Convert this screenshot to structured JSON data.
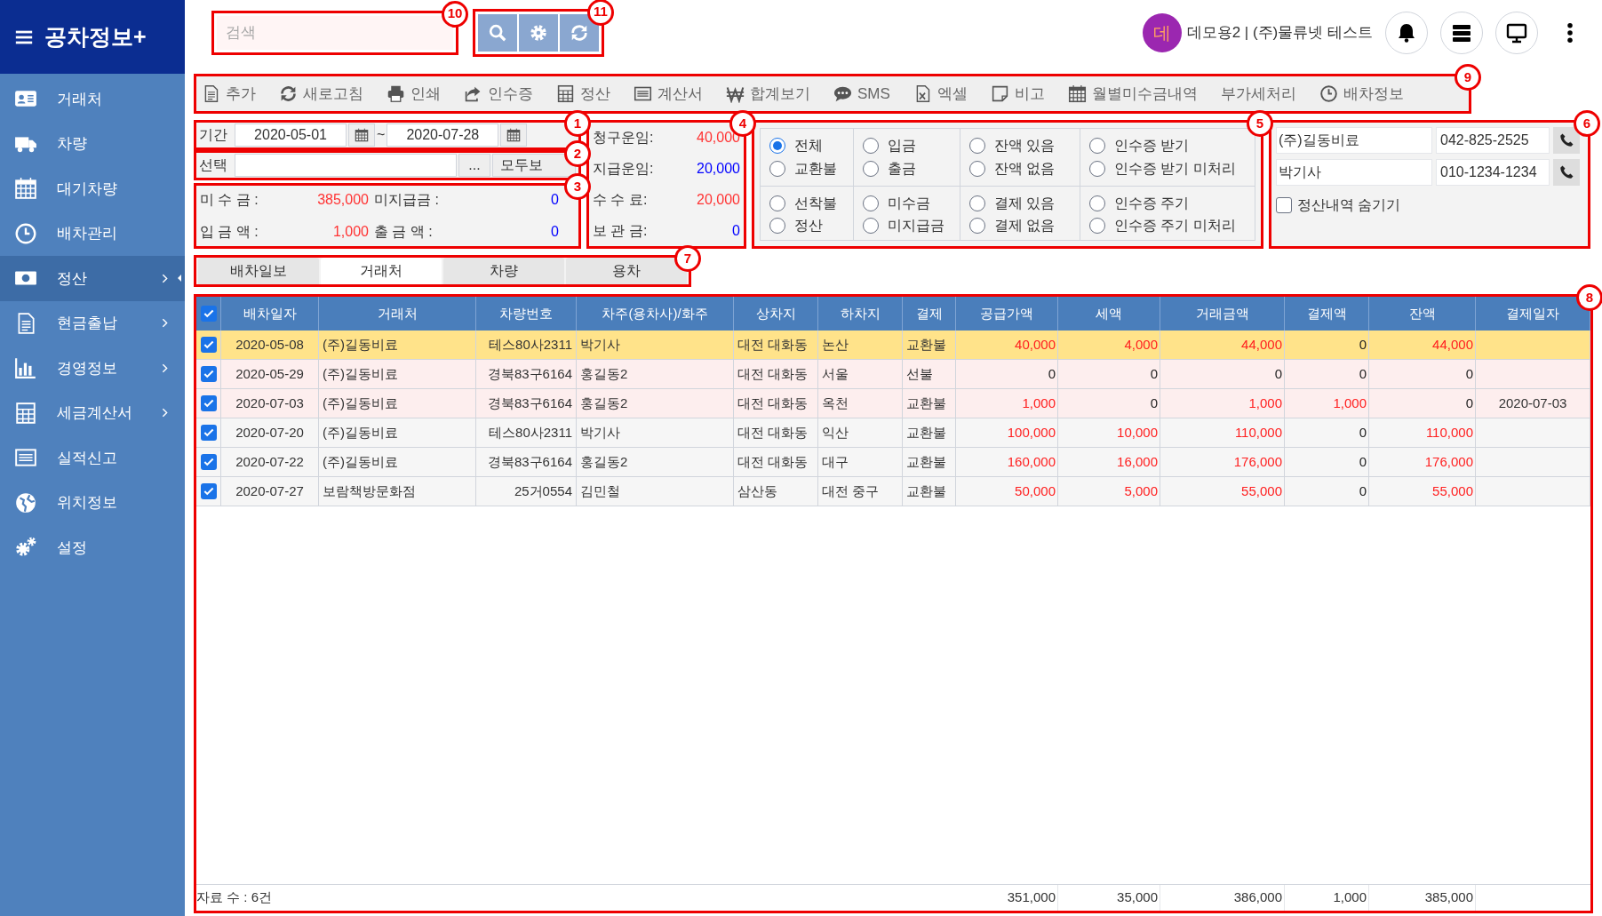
{
  "sidebar": {
    "brand": "공차정보+",
    "items": [
      {
        "label": "거래처",
        "selected": false,
        "submenu": false
      },
      {
        "label": "차량",
        "selected": false,
        "submenu": false
      },
      {
        "label": "대기차량",
        "selected": false,
        "submenu": false
      },
      {
        "label": "배차관리",
        "selected": false,
        "submenu": false
      },
      {
        "label": "정산",
        "selected": true,
        "submenu": true
      },
      {
        "label": "현금출납",
        "selected": false,
        "submenu": true
      },
      {
        "label": "경영정보",
        "selected": false,
        "submenu": true
      },
      {
        "label": "세금계산서",
        "selected": false,
        "submenu": true
      },
      {
        "label": "실적신고",
        "selected": false,
        "submenu": false
      },
      {
        "label": "위치정보",
        "selected": false,
        "submenu": false
      },
      {
        "label": "설정",
        "selected": false,
        "submenu": false
      }
    ]
  },
  "topbar": {
    "search": {
      "placeholder": "검색",
      "callout": "10"
    },
    "tool_buttons": {
      "callout": "11"
    },
    "avatar": "데",
    "user": "데모용2 | (주)물류넷 테스트"
  },
  "toolbar": {
    "callout": "9",
    "items": [
      "추가",
      "새로고침",
      "인쇄",
      "인수증",
      "정산",
      "계산서",
      "합계보기",
      "SMS",
      "엑셀",
      "비고",
      "월별미수금내역",
      "부가세처리",
      "배차정보"
    ]
  },
  "period": {
    "callout": "1",
    "label": "기간",
    "from": "2020-05-01",
    "separator": "~",
    "to": "2020-07-28"
  },
  "selection": {
    "callout": "2",
    "label": "선택",
    "more_button": "...",
    "all_button": "모두보"
  },
  "balances": {
    "callout": "3",
    "items": [
      {
        "label": "미 수 금 :",
        "value": "385,000",
        "color": "#ff3333"
      },
      {
        "label": "미지급금 :",
        "value": "0",
        "color": "#0000ff"
      },
      {
        "label": "입 금 액 :",
        "value": "1,000",
        "color": "#ff3333"
      },
      {
        "label": "출 금 액 :",
        "value": "0",
        "color": "#0000ff"
      }
    ]
  },
  "fees": {
    "callout": "4",
    "items": [
      {
        "label": "청구운임:",
        "value": "40,000",
        "color": "#ff3333"
      },
      {
        "label": "지급운임:",
        "value": "20,000",
        "color": "#0000ff"
      },
      {
        "label": "수 수 료:",
        "value": "20,000",
        "color": "#ff3333"
      },
      {
        "label": "보 관 금:",
        "value": "0",
        "color": "#0000ff"
      }
    ]
  },
  "filters": {
    "callout": "5",
    "groups": [
      {
        "options": [
          {
            "label": "전체",
            "selected": true
          },
          {
            "label": "교환불",
            "selected": false
          },
          {
            "label": "선착불",
            "selected": false
          },
          {
            "label": "정산",
            "selected": false
          }
        ]
      },
      {
        "options": [
          {
            "label": "입금",
            "selected": false
          },
          {
            "label": "출금",
            "selected": false
          },
          {
            "label": "미수금",
            "selected": false
          },
          {
            "label": "미지급금",
            "selected": false
          }
        ]
      },
      {
        "options": [
          {
            "label": "잔액 있음",
            "selected": false
          },
          {
            "label": "잔액 없음",
            "selected": false
          },
          {
            "label": "결제 있음",
            "selected": false
          },
          {
            "label": "결제 없음",
            "selected": false
          }
        ]
      },
      {
        "options": [
          {
            "label": "인수증 받기",
            "selected": false
          },
          {
            "label": "인수증 받기 미처리",
            "selected": false
          },
          {
            "label": "인수증 주기",
            "selected": false
          },
          {
            "label": "인수증 주기 미처리",
            "selected": false
          }
        ]
      }
    ]
  },
  "contact": {
    "callout": "6",
    "rows": [
      {
        "name": "(주)길동비료",
        "phone": "042-825-2525"
      },
      {
        "name": "박기사",
        "phone": "010-1234-1234"
      }
    ],
    "hide_settled": {
      "label": "정산내역 숨기기",
      "checked": false
    }
  },
  "tabs": {
    "callout": "7",
    "items": [
      {
        "label": "배차일보",
        "selected": false
      },
      {
        "label": "거래처",
        "selected": true
      },
      {
        "label": "차량",
        "selected": false
      },
      {
        "label": "용차",
        "selected": false
      }
    ]
  },
  "table": {
    "callout": "8",
    "all_checked": true,
    "columns": [
      "배차일자",
      "거래처",
      "차량번호",
      "차주(용차사)/화주",
      "상차지",
      "하차지",
      "결제",
      "공급가액",
      "세액",
      "거래금액",
      "결제액",
      "잔액",
      "결제일자"
    ],
    "rows": [
      {
        "checked": true,
        "selected": true,
        "flagged": false,
        "cells": [
          "2020-05-08",
          "(주)길동비료",
          "테스80사2311",
          "박기사",
          "대전 대화동",
          "논산",
          "교환불"
        ],
        "amounts": [
          {
            "text": "40,000",
            "red": true
          },
          {
            "text": "4,000",
            "red": true
          },
          {
            "text": "44,000",
            "red": true
          },
          {
            "text": "0",
            "red": false
          },
          {
            "text": "44,000",
            "red": true
          }
        ]
      },
      {
        "checked": true,
        "selected": false,
        "flagged": true,
        "cells": [
          "2020-05-29",
          "(주)길동비료",
          "경북83구6164",
          "홍길동2",
          "대전 대화동",
          "서울",
          "선불"
        ],
        "amounts": [
          {
            "text": "0",
            "red": false
          },
          {
            "text": "0",
            "red": false
          },
          {
            "text": "0",
            "red": false
          },
          {
            "text": "0",
            "red": false
          },
          {
            "text": "0",
            "red": false
          }
        ]
      },
      {
        "checked": true,
        "selected": false,
        "flagged": true,
        "cells": [
          "2020-07-03",
          "(주)길동비료",
          "경북83구6164",
          "홍길동2",
          "대전 대화동",
          "옥천",
          "교환불"
        ],
        "amounts": [
          {
            "text": "1,000",
            "red": true
          },
          {
            "text": "0",
            "red": false
          },
          {
            "text": "1,000",
            "red": true
          },
          {
            "text": "1,000",
            "red": true
          },
          {
            "text": "0",
            "red": false
          }
        ],
        "paid_date": "2020-07-03"
      },
      {
        "checked": true,
        "selected": false,
        "flagged": false,
        "cells": [
          "2020-07-20",
          "(주)길동비료",
          "테스80사2311",
          "박기사",
          "대전 대화동",
          "익산",
          "교환불"
        ],
        "amounts": [
          {
            "text": "100,000",
            "red": true
          },
          {
            "text": "10,000",
            "red": true
          },
          {
            "text": "110,000",
            "red": true
          },
          {
            "text": "0",
            "red": false
          },
          {
            "text": "110,000",
            "red": true
          }
        ]
      },
      {
        "checked": true,
        "selected": false,
        "flagged": false,
        "cells": [
          "2020-07-22",
          "(주)길동비료",
          "경북83구6164",
          "홍길동2",
          "대전 대화동",
          "대구",
          "교환불"
        ],
        "amounts": [
          {
            "text": "160,000",
            "red": true
          },
          {
            "text": "16,000",
            "red": true
          },
          {
            "text": "176,000",
            "red": true
          },
          {
            "text": "0",
            "red": false
          },
          {
            "text": "176,000",
            "red": true
          }
        ]
      },
      {
        "checked": true,
        "selected": false,
        "flagged": false,
        "cells": [
          "2020-07-27",
          "보람책방문화점",
          "25거0554",
          "김민철",
          "삼산동",
          "대전 중구",
          "교환불"
        ],
        "amounts": [
          {
            "text": "50,000",
            "red": true
          },
          {
            "text": "5,000",
            "red": true
          },
          {
            "text": "55,000",
            "red": true
          },
          {
            "text": "0",
            "red": false
          },
          {
            "text": "55,000",
            "red": true
          }
        ]
      }
    ],
    "footer": {
      "count": "자료 수 : 6건",
      "totals": [
        "351,000",
        "35,000",
        "386,000",
        "1,000",
        "385,000"
      ]
    }
  }
}
